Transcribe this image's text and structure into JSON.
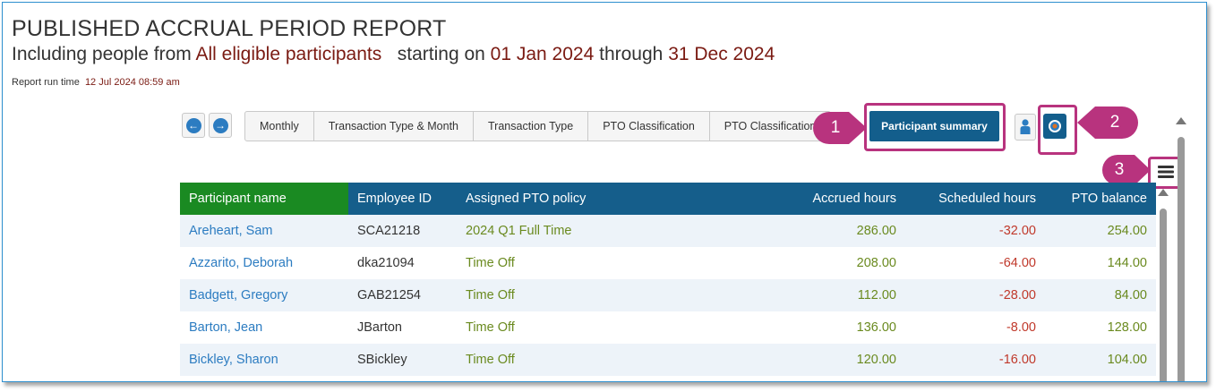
{
  "header": {
    "title": "PUBLISHED ACCRUAL PERIOD REPORT",
    "subtitle_prefix": "Including people from ",
    "subtitle_population": "All eligible participants",
    "subtitle_starting": "starting on ",
    "subtitle_start_date": "01 Jan 2024",
    "subtitle_through": " through ",
    "subtitle_end_date": "31 Dec 2024",
    "run_time_label": "Report run time",
    "run_time_value": "12 Jul 2024 08:59 am"
  },
  "toolbar": {
    "prev_icon": "←",
    "next_icon": "→",
    "tabs": [
      "Monthly",
      "Transaction Type & Month",
      "Transaction Type",
      "PTO Classification",
      "PTO Classification"
    ],
    "active_tab": "Participant summary"
  },
  "callouts": {
    "one": "1",
    "two": "2",
    "three": "3"
  },
  "table": {
    "columns": [
      "Participant name",
      "Employee ID",
      "Assigned PTO policy",
      "Accrued hours",
      "Scheduled hours",
      "PTO balance"
    ],
    "rows": [
      {
        "name": "Areheart, Sam",
        "id": "SCA21218",
        "policy": "2024 Q1 Full Time",
        "accrued": "286.00",
        "scheduled": "-32.00",
        "balance": "254.00"
      },
      {
        "name": "Azzarito, Deborah",
        "id": "dka21094",
        "policy": "Time Off",
        "accrued": "208.00",
        "scheduled": "-64.00",
        "balance": "144.00"
      },
      {
        "name": "Badgett, Gregory",
        "id": "GAB21254",
        "policy": "Time Off",
        "accrued": "112.00",
        "scheduled": "-28.00",
        "balance": "84.00"
      },
      {
        "name": "Barton, Jean",
        "id": "JBarton",
        "policy": "Time Off",
        "accrued": "136.00",
        "scheduled": "-8.00",
        "balance": "128.00"
      },
      {
        "name": "Bickley, Sharon",
        "id": "SBickley",
        "policy": "Time Off",
        "accrued": "120.00",
        "scheduled": "-16.00",
        "balance": "104.00"
      }
    ]
  },
  "colors": {
    "header_blue": "#155e8b",
    "header_green": "#1a8a22",
    "callout_magenta": "#b8337e",
    "link_blue": "#2c7cc1",
    "policy_olive": "#6a8a1f",
    "negative_red": "#c0392b",
    "accent_maroon": "#7a1a12"
  }
}
